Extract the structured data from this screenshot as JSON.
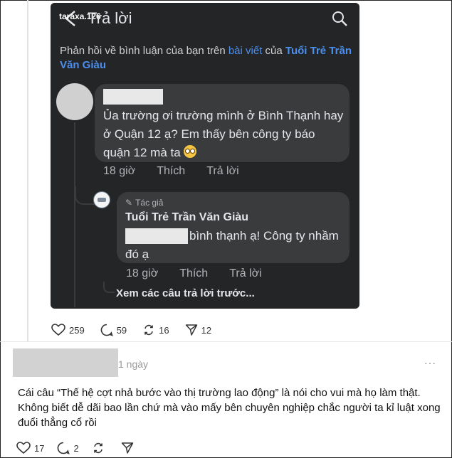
{
  "embedded": {
    "watermark": "taraxa.126",
    "title": "Trả lời",
    "notice": {
      "prefix": "Phản hồi về bình luận của bạn trên ",
      "link_post": "bài viết",
      "middle": " của ",
      "link_page": "Tuổi Trẻ Trần Văn Giàu"
    },
    "comment1": {
      "text": "Ủa trường ơi trường mình ở Bình Thạnh hay ở Quận 12 ạ? Em thấy bên công ty báo quận 12 mà ta",
      "time": "18 giờ",
      "like": "Thích",
      "reply": "Trả lời"
    },
    "reply1": {
      "badge": "Tác giả",
      "author": "Tuổi Trẻ Trần Văn Giàu",
      "text": "bình thạnh ạ! Công ty nhầm đó ạ",
      "time": "18 giờ",
      "like": "Thích",
      "reply": "Trả lời"
    },
    "see_more": "Xem các câu trả lời trước..."
  },
  "post_stats": {
    "likes": "259",
    "comments": "59",
    "reposts": "16",
    "shares": "12"
  },
  "comment": {
    "time": "1 ngày",
    "more": "···",
    "text": "Cái câu “Thế hệ cợt nhả bước vào thị trường lao động” là nói cho vui mà họ làm thật. Không biết dễ dãi bao lần chứ mà vào mấy bên chuyên nghiệp chắc người ta kỉ luật xong đuổi thẳng cổ rồi",
    "likes": "17",
    "replies": "2"
  },
  "icons": [
    "back-arrow-icon",
    "search-icon",
    "pen-icon",
    "heart-icon",
    "comment-icon",
    "repost-icon",
    "send-icon",
    "emoji-icon"
  ],
  "colors": {
    "dark_bg": "#242526",
    "bubble": "#3a3b3c",
    "link": "#4b8ff0"
  }
}
